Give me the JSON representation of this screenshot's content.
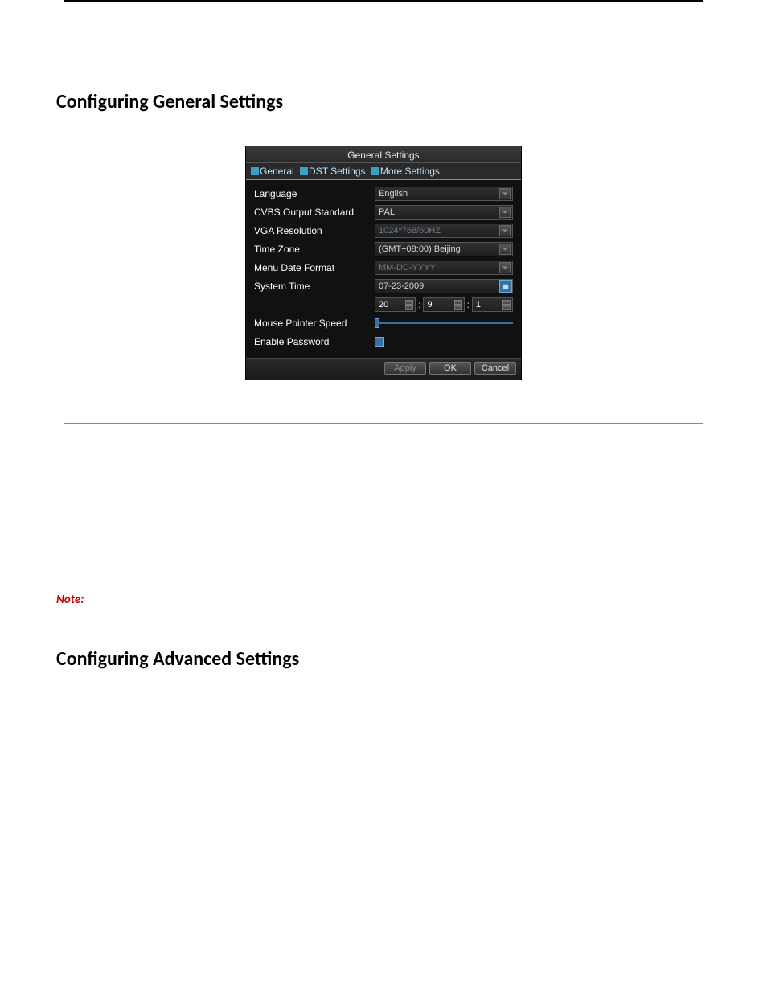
{
  "headings": {
    "general": "Configuring General Settings",
    "advanced": "Configuring Advanced Settings"
  },
  "dialog": {
    "title": "General Settings",
    "tabs": {
      "t1": "General",
      "t2": "DST Settings",
      "t3": "More Settings"
    },
    "labels": {
      "language": "Language",
      "cvbs": "CVBS Output Standard",
      "vga": "VGA Resolution",
      "tz": "Time Zone",
      "datefmt": "Menu Date Format",
      "systime": "System Time",
      "mouse": "Mouse Pointer Speed",
      "pwd": "Enable Password"
    },
    "values": {
      "language": "English",
      "cvbs": "PAL",
      "vga": "1024*768/60HZ",
      "tz": "(GMT+08:00) Beijing",
      "datefmt": "MM-DD-YYYY",
      "date": "07-23-2009",
      "hh": "20",
      "mm": "9",
      "ss": "1"
    },
    "buttons": {
      "apply": "Apply",
      "ok": "OK",
      "cancel": "Cancel"
    }
  },
  "note": "Note:"
}
